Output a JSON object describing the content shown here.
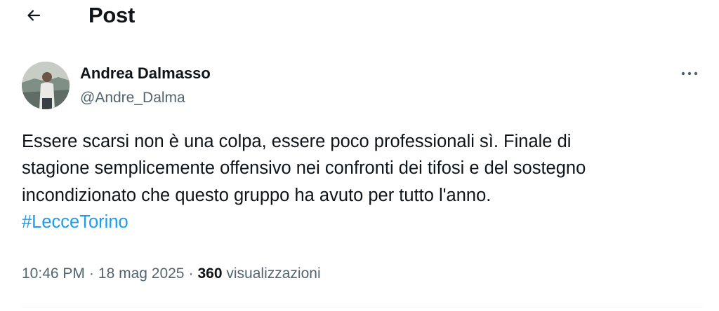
{
  "header": {
    "title": "Post",
    "back_icon": "arrow-left-icon"
  },
  "post": {
    "author": {
      "name": "Andrea Dalmasso",
      "handle": "@Andre_Dalma"
    },
    "more_icon": "more-horizontal-icon",
    "text_lines": [
      "Essere scarsi non è una colpa, essere poco professionali sì. Finale di",
      "stagione semplicemente offensivo nei confronti dei tifosi e del sostegno",
      "incondizionato che questo gruppo ha avuto per tutto l'anno."
    ],
    "hashtag": "#LecceTorino",
    "time": "10:46 PM",
    "date": "18 mag 2025",
    "views_count": "360",
    "views_label": "visualizzazioni"
  },
  "colors": {
    "text": "#0f1419",
    "secondary": "#536471",
    "accent": "#1d9bf0",
    "divider": "#eff3f4"
  }
}
